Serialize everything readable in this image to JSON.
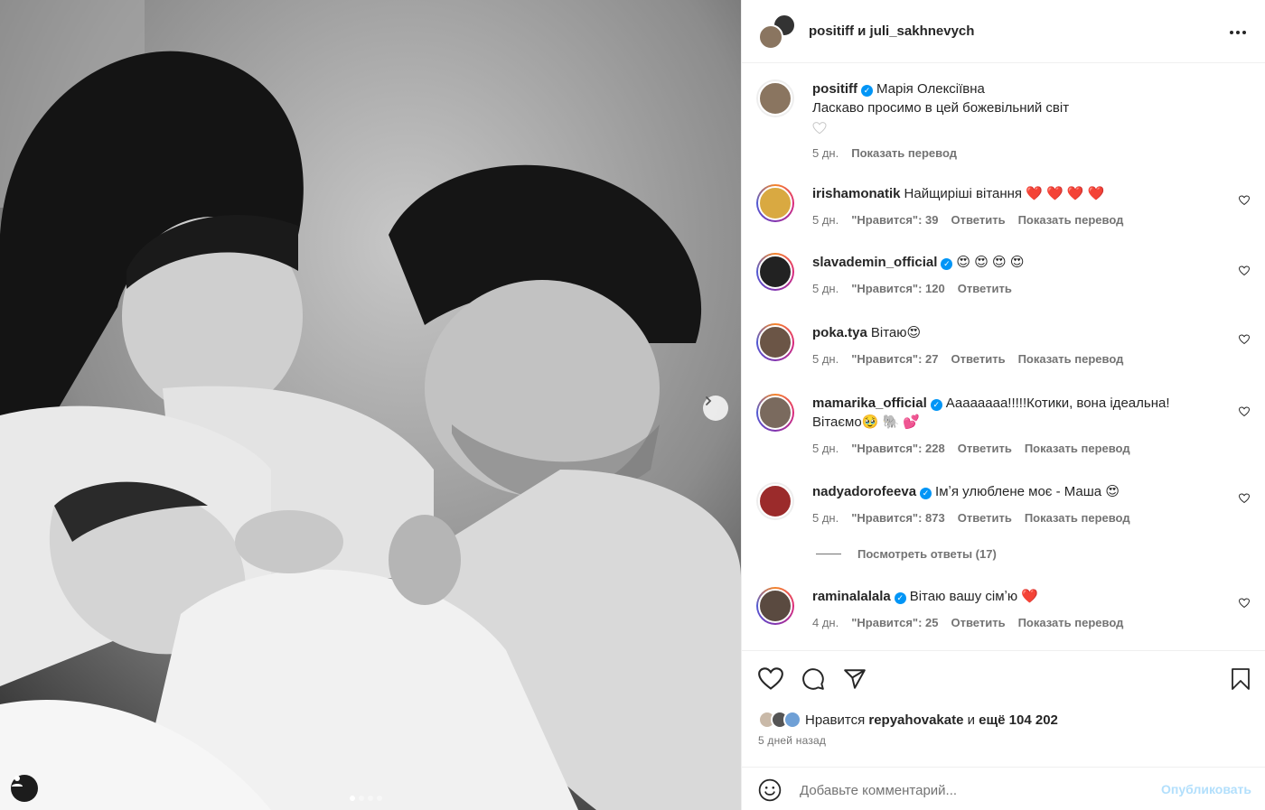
{
  "header": {
    "names": "positiff и juli_sakhnevych",
    "more": "•••"
  },
  "caption": {
    "username": "positiff",
    "mention": "Марія Олексіївна",
    "text": "Ласкаво просимо в цей божевільний світ",
    "time": "5 дн.",
    "translate": "Показать перевод"
  },
  "comments": [
    {
      "username": "irishamonatik",
      "verified": false,
      "text": "Найщиріші вітання ❤️ ❤️ ❤️ ❤️",
      "time": "5 дн.",
      "likes": "\"Нравится\": 39",
      "reply": "Ответить",
      "translate": "Показать перевод",
      "color": "#d9a941"
    },
    {
      "username": "slavademin_official",
      "verified": true,
      "text": "😍 😍 😍 😍",
      "time": "5 дн.",
      "likes": "\"Нравится\": 120",
      "reply": "Ответить",
      "translate": "",
      "color": "#222222"
    },
    {
      "username": "poka.tya",
      "verified": false,
      "text": "Вітаю😍",
      "time": "5 дн.",
      "likes": "\"Нравится\": 27",
      "reply": "Ответить",
      "translate": "Показать перевод",
      "color": "#6b5546"
    },
    {
      "username": "mamarika_official",
      "verified": true,
      "text": "Аааааааа!!!!!Котики, вона ідеальна! Вітаємо🥹 🐘 💕",
      "time": "5 дн.",
      "likes": "\"Нравится\": 228",
      "reply": "Ответить",
      "translate": "Показать перевод",
      "color": "#7a6a5e"
    },
    {
      "username": "nadyadorofeeva",
      "verified": true,
      "text": "Імʼя улюблене моє - Маша 😍",
      "time": "5 дн.",
      "likes": "\"Нравится\": 873",
      "reply": "Ответить",
      "translate": "Показать перевод",
      "color": "#9b2b2b"
    },
    {
      "username": "raminalalala",
      "verified": true,
      "text": "Вітаю вашу сімʼю ❤️",
      "time": "4 дн.",
      "likes": "\"Нравится\": 25",
      "reply": "Ответить",
      "translate": "Показать перевод",
      "color": "#5a4a40"
    }
  ],
  "view_replies": "Посмотреть ответы (17)",
  "likes_line": {
    "prefix": "Нравится",
    "user": "repyahovakate",
    "middle": "и",
    "rest": "ещё 104 202"
  },
  "posted_ago": "5 дней назад",
  "add_comment": {
    "placeholder": "Добавьте комментарий...",
    "post": "Опубликовать"
  },
  "colors": {
    "accent": "#0095f6",
    "muted": "#737373"
  },
  "icons": [
    "more-icon",
    "verified-icon",
    "heart-icon",
    "comment-icon",
    "share-icon",
    "bookmark-icon",
    "emoji-icon",
    "chevron-right-icon",
    "user-tag-icon"
  ]
}
